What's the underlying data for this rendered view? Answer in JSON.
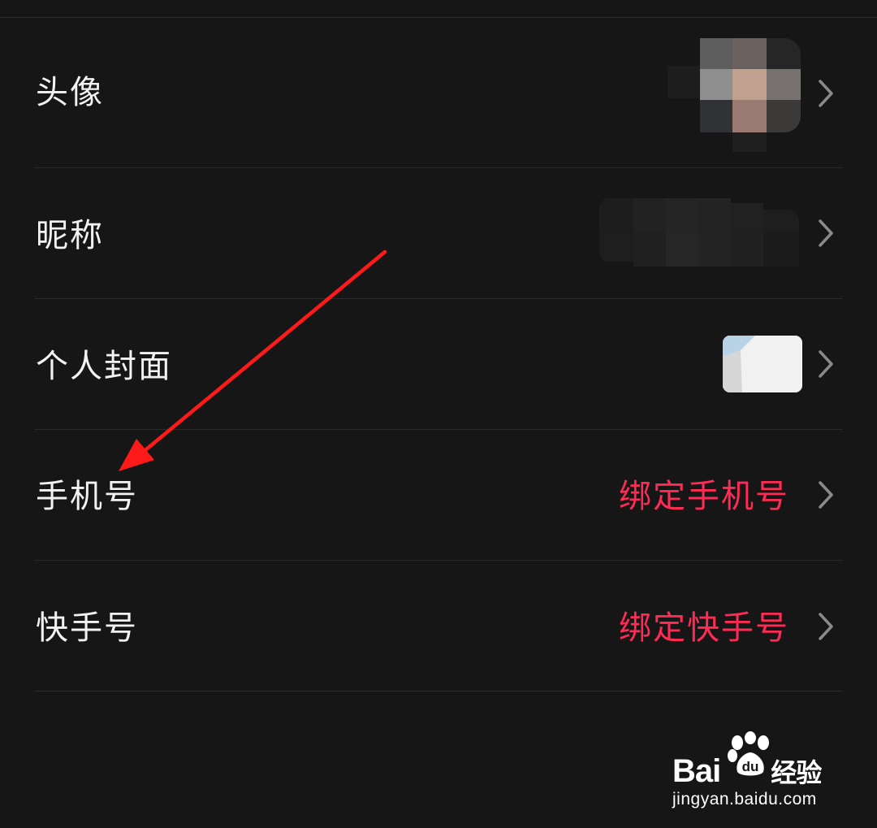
{
  "rows": [
    {
      "label": "头像"
    },
    {
      "label": "昵称"
    },
    {
      "label": "个人封面"
    },
    {
      "label": "手机号",
      "value": "绑定手机号"
    },
    {
      "label": "快手号",
      "value": "绑定快手号"
    }
  ],
  "colors": {
    "background": "#161616",
    "accent": "#fe2c55",
    "divider": "#2b2b2b",
    "annotation_arrow": "#ff1a1a"
  },
  "icons": {
    "chevron": "chevron-right-icon",
    "paw": "paw-icon"
  },
  "watermark": {
    "brand_left": "Bai",
    "brand_right": "经验",
    "url": "jingyan.baidu.com"
  }
}
